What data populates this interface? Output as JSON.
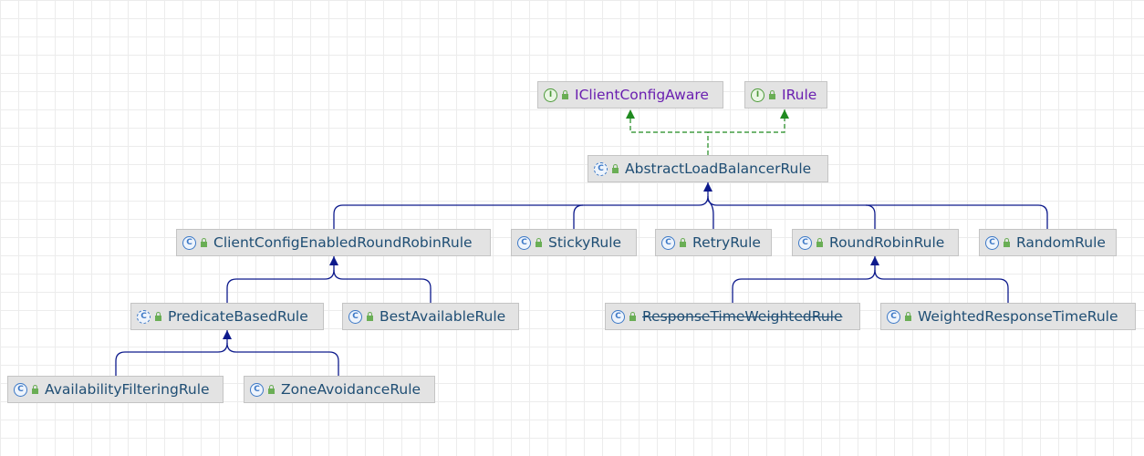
{
  "diagram": {
    "nodes": {
      "iclientconfigaware": {
        "label": "IClientConfigAware",
        "kind": "interface"
      },
      "irule": {
        "label": "IRule",
        "kind": "interface"
      },
      "abstractloadbalancerrule": {
        "label": "AbstractLoadBalancerRule",
        "kind": "abstract"
      },
      "clientconfigenabledroundrobinrule": {
        "label": "ClientConfigEnabledRoundRobinRule",
        "kind": "class"
      },
      "stickyrule": {
        "label": "StickyRule",
        "kind": "class"
      },
      "retryrule": {
        "label": "RetryRule",
        "kind": "class"
      },
      "roundrobinrule": {
        "label": "RoundRobinRule",
        "kind": "class"
      },
      "randomrule": {
        "label": "RandomRule",
        "kind": "class"
      },
      "predicatebasedrule": {
        "label": "PredicateBasedRule",
        "kind": "abstract"
      },
      "bestavailablerule": {
        "label": "BestAvailableRule",
        "kind": "class"
      },
      "responsetimeweightedrule": {
        "label": "ResponseTimeWeightedRule",
        "kind": "class",
        "deprecated": true
      },
      "weightedresponsetimerule": {
        "label": "WeightedResponseTimeRule",
        "kind": "class"
      },
      "availabilityfilteringrule": {
        "label": "AvailabilityFilteringRule",
        "kind": "class"
      },
      "zoneavoidancerule": {
        "label": "ZoneAvoidanceRule",
        "kind": "class"
      }
    },
    "relations": [
      {
        "from": "abstractloadbalancerrule",
        "to": "iclientconfigaware",
        "type": "implements"
      },
      {
        "from": "abstractloadbalancerrule",
        "to": "irule",
        "type": "implements"
      },
      {
        "from": "clientconfigenabledroundrobinrule",
        "to": "abstractloadbalancerrule",
        "type": "extends"
      },
      {
        "from": "stickyrule",
        "to": "abstractloadbalancerrule",
        "type": "extends"
      },
      {
        "from": "retryrule",
        "to": "abstractloadbalancerrule",
        "type": "extends"
      },
      {
        "from": "roundrobinrule",
        "to": "abstractloadbalancerrule",
        "type": "extends"
      },
      {
        "from": "randomrule",
        "to": "abstractloadbalancerrule",
        "type": "extends"
      },
      {
        "from": "predicatebasedrule",
        "to": "clientconfigenabledroundrobinrule",
        "type": "extends"
      },
      {
        "from": "bestavailablerule",
        "to": "clientconfigenabledroundrobinrule",
        "type": "extends"
      },
      {
        "from": "responsetimeweightedrule",
        "to": "roundrobinrule",
        "type": "extends"
      },
      {
        "from": "weightedresponsetimerule",
        "to": "roundrobinrule",
        "type": "extends"
      },
      {
        "from": "availabilityfilteringrule",
        "to": "predicatebasedrule",
        "type": "extends"
      },
      {
        "from": "zoneavoidancerule",
        "to": "predicatebasedrule",
        "type": "extends"
      }
    ],
    "colors": {
      "extends_edge": "#0d1a8c",
      "implements_edge": "#1f8a1f",
      "class_text": "#1f4e74",
      "interface_text": "#6a1fb0",
      "node_fill": "#e3e3e3"
    },
    "icons": {
      "class": "class-icon",
      "interface": "interface-icon",
      "abstract": "abstract-class-icon",
      "access": "public-access-icon"
    }
  }
}
